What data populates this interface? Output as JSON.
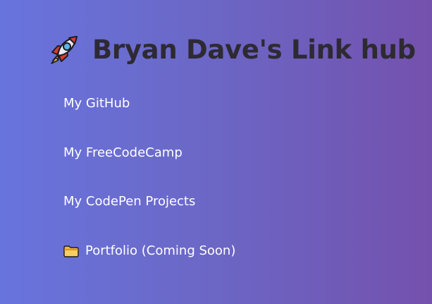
{
  "header": {
    "icon": "rocket-icon",
    "title": "Bryan Dave's Link hub"
  },
  "links": [
    {
      "label": "My GitHub"
    },
    {
      "label": "My FreeCodeCamp"
    },
    {
      "label": "My CodePen Projects"
    },
    {
      "label": "Portfolio (Coming Soon)",
      "icon": "folder-icon"
    }
  ],
  "colors": {
    "background_left": "#6874dd",
    "background_right": "#7451ad",
    "title": "#2e2a33",
    "link_text": "#ffffff"
  }
}
